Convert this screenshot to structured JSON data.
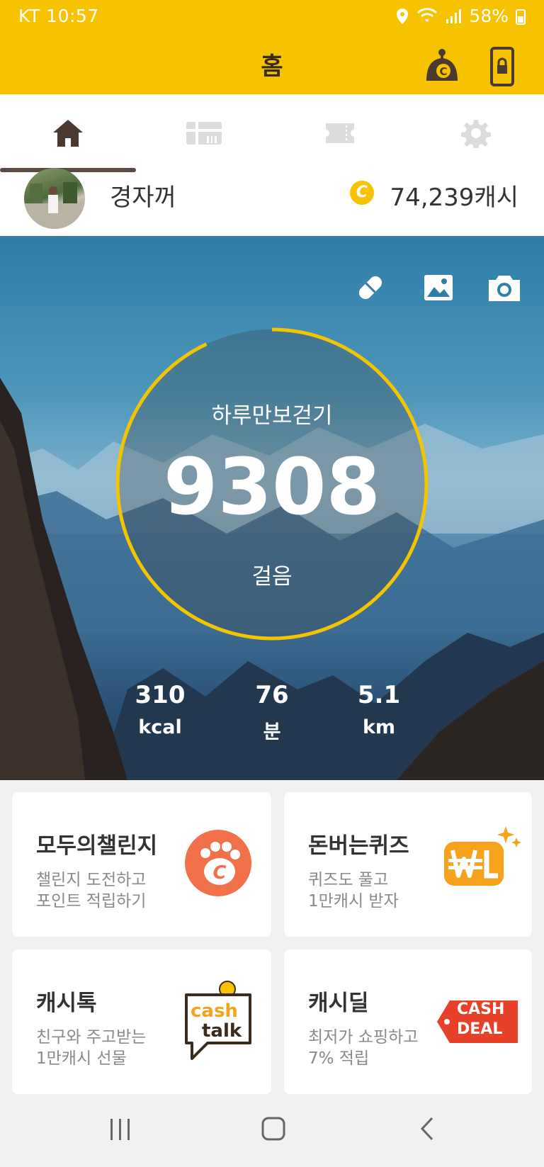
{
  "status_bar": {
    "carrier_time": "KT 10:57",
    "battery": "58%"
  },
  "header": {
    "title": "홈"
  },
  "tabs": [
    {
      "name": "home",
      "icon": "home-icon"
    },
    {
      "name": "coupon",
      "icon": "gift-card-icon"
    },
    {
      "name": "ticket",
      "icon": "ticket-icon"
    },
    {
      "name": "settings",
      "icon": "gear-icon"
    }
  ],
  "profile": {
    "username": "경자꺼",
    "coin_symbol": "C",
    "cash": "74,239캐시"
  },
  "pedometer": {
    "goal_label": "하루만보걷기",
    "steps": "9308",
    "steps_unit": "걸음",
    "progress": 0.93,
    "stats": [
      {
        "value": "310",
        "unit": "kcal"
      },
      {
        "value": "76",
        "unit": "분"
      },
      {
        "value": "5.1",
        "unit": "km"
      }
    ]
  },
  "cards": [
    {
      "title": "모두의챌린지",
      "line1": "챌린지 도전하고",
      "line2": "포인트 적립하기",
      "icon": "paw-coin-icon"
    },
    {
      "title": "돈버는퀴즈",
      "line1": "퀴즈도 풀고",
      "line2": "1만캐시 받자",
      "icon": "won-quiz-icon"
    },
    {
      "title": "캐시톡",
      "line1": "친구와 주고받는",
      "line2": "1만캐시 선물",
      "icon": "cash-talk-icon",
      "badge_top": "cash",
      "badge_bottom": "talk"
    },
    {
      "title": "캐시딜",
      "line1": "최저가 쇼핑하고",
      "line2": "7% 적립",
      "icon": "cash-deal-icon",
      "badge_top": "CASH",
      "badge_bottom": "DEAL"
    }
  ],
  "colors": {
    "brand_yellow": "#f7c300",
    "ring": "#f2c500",
    "deal_red": "#e8412a",
    "challenge_orange": "#f2704a",
    "quiz_orange": "#f6a21c"
  }
}
